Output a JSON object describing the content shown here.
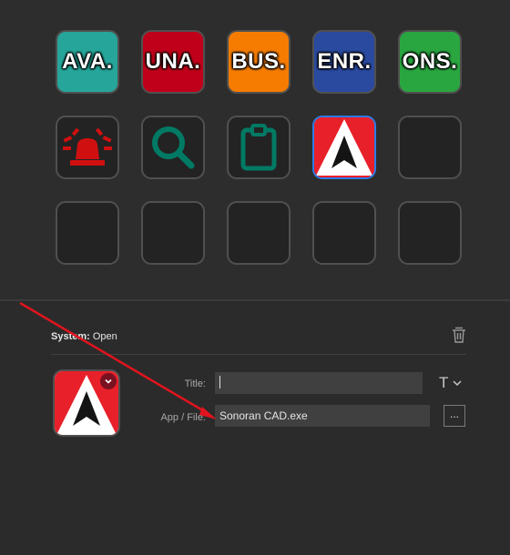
{
  "keys": {
    "row1": [
      {
        "label": "AVA.",
        "color": "#26a69a"
      },
      {
        "label": "UNA.",
        "color": "#c0001a"
      },
      {
        "label": "BUS.",
        "color": "#f57c00"
      },
      {
        "label": "ENR.",
        "color": "#2a4aa0"
      },
      {
        "label": "ONS.",
        "color": "#2aa640"
      }
    ],
    "row2": [
      {
        "icon": "siren-icon",
        "color": "#d01010"
      },
      {
        "icon": "magnifier-icon",
        "color": "#007a64"
      },
      {
        "icon": "clipboard-icon",
        "color": "#007a64"
      },
      {
        "icon": "sonoran-cad-logo"
      },
      {
        "icon": "empty"
      }
    ],
    "row3_empty_count": 5
  },
  "inspector": {
    "action_category": "System:",
    "action_name": "Open",
    "title_label": "Title:",
    "title_value": "",
    "file_label": "App / File:",
    "file_value": "Sonoran CAD.exe",
    "font_button": "T",
    "browse_button": "..."
  },
  "colors": {
    "selection": "#2c7be5",
    "annotation_arrow": "#e0141e",
    "logo_red": "#e8202a"
  }
}
